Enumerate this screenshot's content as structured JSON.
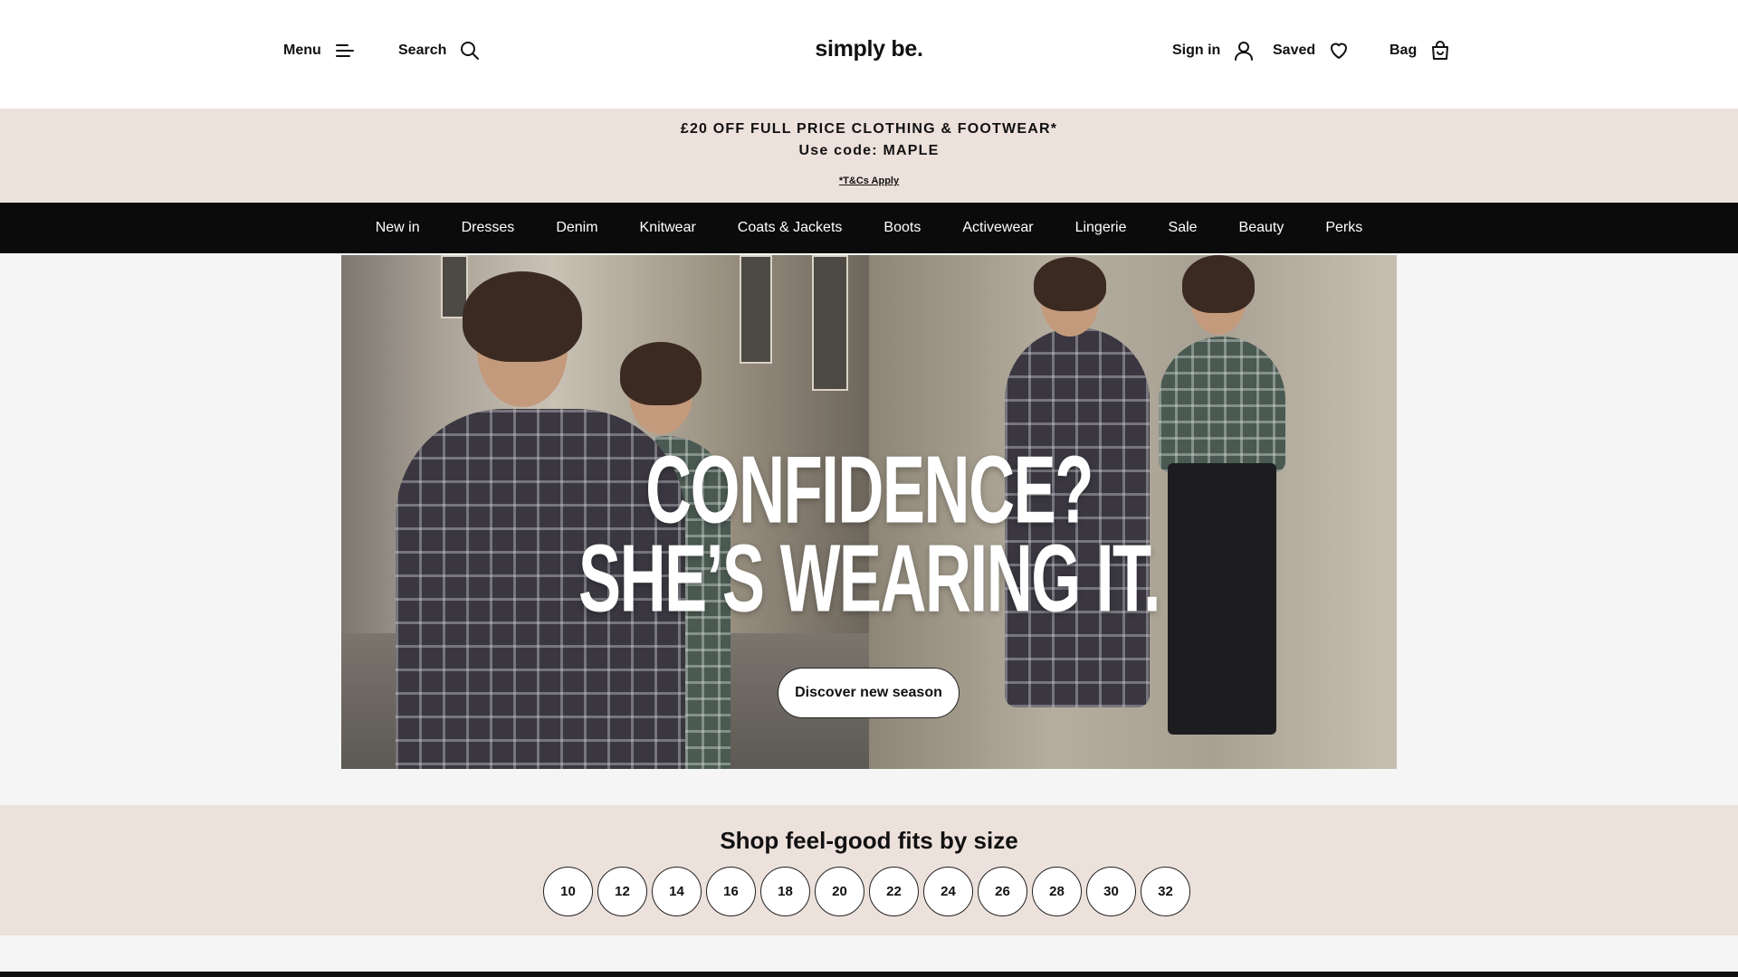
{
  "header": {
    "menu_label": "Menu",
    "search_label": "Search",
    "logo_text": "simply be.",
    "signin_label": "Sign in",
    "saved_label": "Saved",
    "bag_label": "Bag"
  },
  "promo": {
    "line1": "£20 OFF FULL PRICE CLOTHING & FOOTWEAR*",
    "line2": "Use code: MAPLE",
    "terms": "*T&Cs Apply"
  },
  "nav": {
    "items": [
      "New in",
      "Dresses",
      "Denim",
      "Knitwear",
      "Coats & Jackets",
      "Boots",
      "Activewear",
      "Lingerie",
      "Sale",
      "Beauty",
      "Perks"
    ]
  },
  "hero": {
    "headline_line1": "CONFIDENCE?",
    "headline_line2": "SHE’S WEARING IT.",
    "cta_label": "Discover new season"
  },
  "sizes": {
    "title": "Shop feel-good fits by size",
    "options": [
      "10",
      "12",
      "14",
      "16",
      "18",
      "20",
      "22",
      "24",
      "26",
      "28",
      "30",
      "32"
    ]
  },
  "icons": {
    "menu": "menu-icon",
    "search": "search-icon",
    "signin": "user-icon",
    "saved": "heart-icon",
    "bag": "bag-icon"
  },
  "colors": {
    "promo_bg": "#ede1db",
    "nav_bg": "#0b0b0b",
    "page_bg": "#f5f5f5"
  }
}
